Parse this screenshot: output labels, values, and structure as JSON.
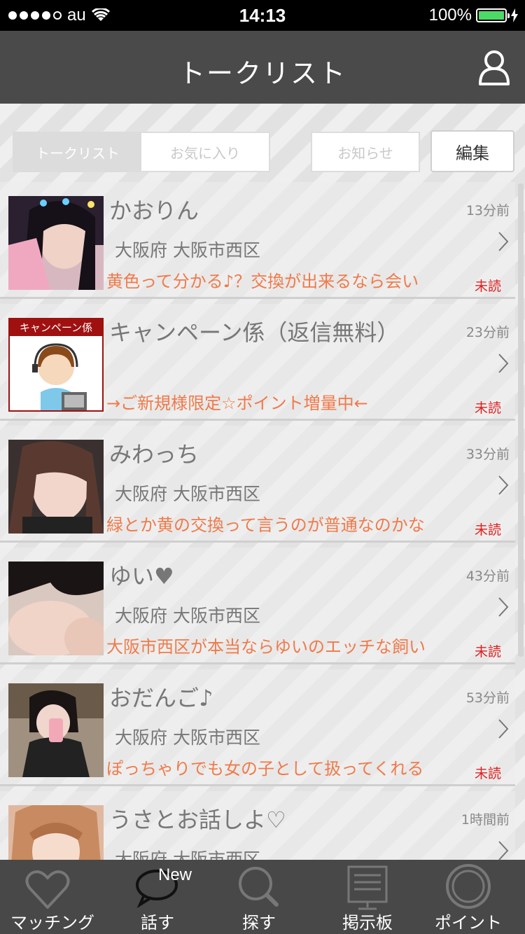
{
  "status_bar": {
    "carrier": "au",
    "time": "14:13",
    "battery": "100%"
  },
  "header": {
    "title": "トークリスト"
  },
  "tabs": [
    {
      "label": "トークリスト",
      "active": true
    },
    {
      "label": "お気に入り",
      "active": false
    }
  ],
  "buttons": {
    "notice": "お知らせ",
    "edit": "編集"
  },
  "conversations": [
    {
      "name": "かおりん",
      "time": "13分前",
      "location": "大阪府 大阪市西区",
      "message": "黄色って分かる♪？交換が出来るなら会い",
      "status": "未読"
    },
    {
      "name": "キャンペーン係（返信無料）",
      "time": "23分前",
      "location": "",
      "message": "→ご新規様限定☆ポイント増量中←",
      "status": "未読",
      "avatar_label": "キャンペーン係"
    },
    {
      "name": "みわっち",
      "time": "33分前",
      "location": "大阪府 大阪市西区",
      "message": "緑とか黄の交換って言うのが普通なのかな",
      "status": "未読"
    },
    {
      "name": "ゆい♥",
      "time": "43分前",
      "location": "大阪府 大阪市西区",
      "message": "大阪市西区が本当ならゆいのエッチな飼い",
      "status": "未読"
    },
    {
      "name": "おだんご♪",
      "time": "53分前",
      "location": "大阪府 大阪市西区",
      "message": "ぽっちゃりでも女の子として扱ってくれる",
      "status": "未読"
    },
    {
      "name": "うさとお話しよ♡",
      "time": "1時間前",
      "location": "大阪府 大阪市西区",
      "message": "",
      "status": ""
    }
  ],
  "tab_bar": {
    "badge": "New",
    "items": [
      {
        "label": "マッチング",
        "icon": "heart-icon"
      },
      {
        "label": "話す",
        "icon": "speech-bubble-icon"
      },
      {
        "label": "探す",
        "icon": "magnifier-icon"
      },
      {
        "label": "掲示板",
        "icon": "board-icon"
      },
      {
        "label": "ポイント",
        "icon": "coin-icon"
      }
    ]
  },
  "colors": {
    "message": "#f07a4a",
    "unread": "#e02020",
    "navbar": "#4a4a4a",
    "tabbar": "#484848"
  }
}
